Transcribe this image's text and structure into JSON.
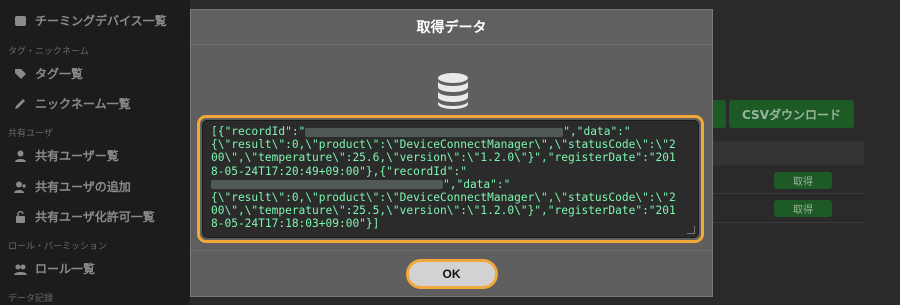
{
  "sidebar": {
    "items": [
      {
        "label": "チーミングデバイス一覧",
        "icon": "device-icon"
      },
      {
        "section": "タグ・ニックネーム"
      },
      {
        "label": "タグ一覧",
        "icon": "tag-icon"
      },
      {
        "label": "ニックネーム一覧",
        "icon": "pencil-icon"
      },
      {
        "section": "共有ユーザ"
      },
      {
        "label": "共有ユーザー覧",
        "icon": "user-icon"
      },
      {
        "label": "共有ユーザの追加",
        "icon": "user-plus-icon"
      },
      {
        "label": "共有ユーザ化許可一覧",
        "icon": "lock-icon"
      },
      {
        "section": "ロール・パーミッション"
      },
      {
        "label": "ロール一覧",
        "icon": "users-icon"
      },
      {
        "section": "データ記録"
      }
    ]
  },
  "main": {
    "csv_button": "CSVダウンロード",
    "row_buttons": [
      "取得",
      "取得"
    ]
  },
  "modal": {
    "title": "取得データ",
    "icon": "database-icon",
    "json_lines": [
      [
        "[{\"recordId\":\"",
        "BLUR",
        "\",\"data\":\""
      ],
      [
        "{\\\"result\\\":0,\\\"product\\\":\\\"DeviceConnectManager\\\",\\\"statusCode\\\":\\\"2"
      ],
      [
        "00\\\",\\\"temperature\\\":25.6,\\\"version\\\":\\\"1.2.0\\\"}\",\"registerDate\":\"201"
      ],
      [
        "8-05-24T17:20:49+09:00\"},{\"recordId\":\""
      ],
      [
        "BLUR2",
        "\",\"data\":\""
      ],
      [
        "{\\\"result\\\":0,\\\"product\\\":\\\"DeviceConnectManager\\\",\\\"statusCode\\\":\\\"2"
      ],
      [
        "00\\\",\\\"temperature\\\":25.5,\\\"version\\\":\\\"1.2.0\\\"}\",\"registerDate\":\"201"
      ],
      [
        "8-05-24T17:18:03+09:00\"}]"
      ]
    ],
    "ok_label": "OK"
  },
  "colors": {
    "highlight": "#f2a83b",
    "json_text": "#7df7b0",
    "button_green": "#1e5a26"
  }
}
